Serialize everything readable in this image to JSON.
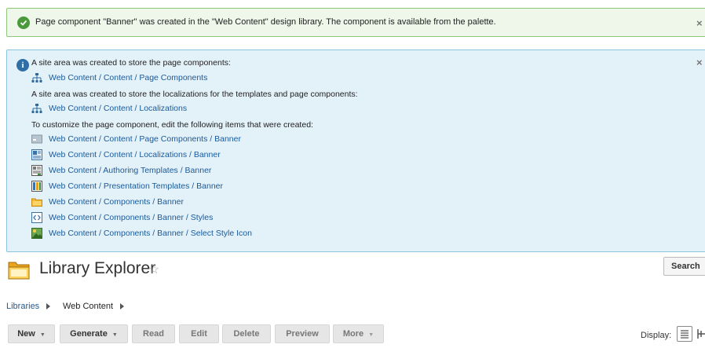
{
  "success_message": {
    "text": "Page component \"Banner\" was created in the \"Web Content\" design library. The component is available from the palette.",
    "close": "×"
  },
  "info_message": {
    "close": "×",
    "line1": "A site area was created to store the page components:",
    "link1": "Web Content / Content / Page Components",
    "line2": "A site area was created to store the localizations for the templates and page components:",
    "link2": "Web Content / Content / Localizations",
    "line3": "To customize the page component, edit the following items that were created:",
    "items": [
      {
        "label": "Web Content / Content / Page Components / Banner",
        "icon": "content-item-icon"
      },
      {
        "label": "Web Content / Content / Localizations / Banner",
        "icon": "localization-icon"
      },
      {
        "label": "Web Content / Authoring Templates / Banner",
        "icon": "authoring-template-icon"
      },
      {
        "label": "Web Content / Presentation Templates / Banner",
        "icon": "presentation-template-icon"
      },
      {
        "label": "Web Content / Components / Banner",
        "icon": "component-folder-icon"
      },
      {
        "label": "Web Content / Components / Banner / Styles",
        "icon": "html-component-icon"
      },
      {
        "label": "Web Content / Components / Banner / Select Style Icon",
        "icon": "image-component-icon"
      }
    ]
  },
  "explorer": {
    "title": "Library Explorer",
    "star": "☆",
    "search": "Search",
    "breadcrumb": [
      "Libraries",
      "Web Content"
    ]
  },
  "toolbar": {
    "new": "New",
    "generate": "Generate",
    "read": "Read",
    "edit": "Edit",
    "delete": "Delete",
    "preview": "Preview",
    "more": "More",
    "display_label": "Display:"
  }
}
